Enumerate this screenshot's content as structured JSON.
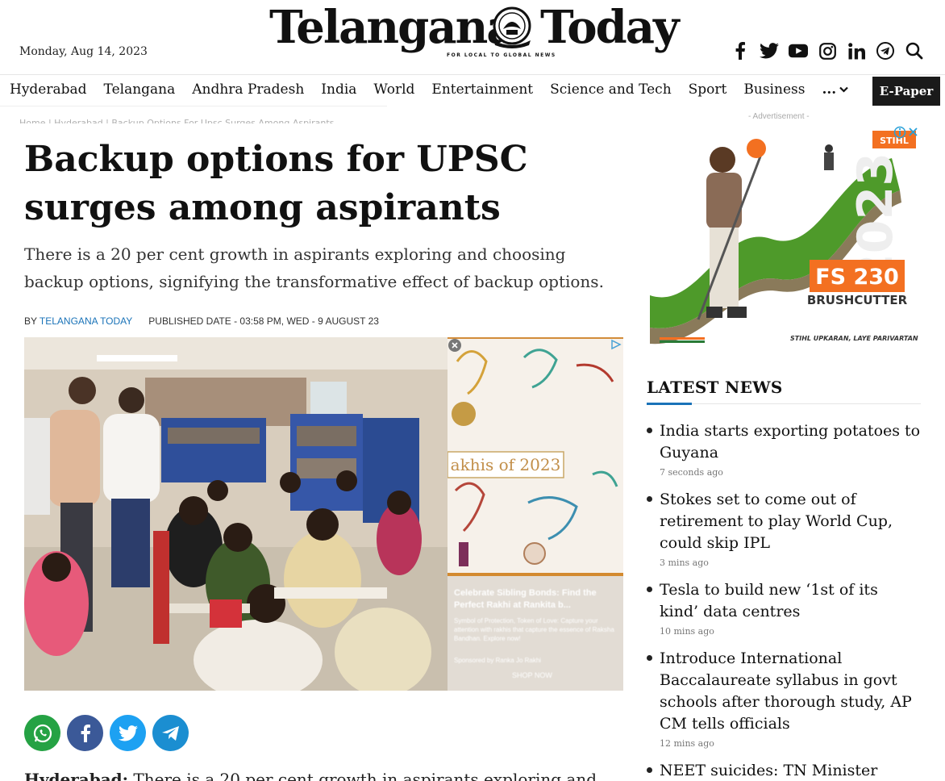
{
  "header": {
    "date": "Monday, Aug 14, 2023",
    "logo_left": "Telangana",
    "logo_right": "Today",
    "logo_tagline": "FOR LOCAL TO GLOBAL NEWS",
    "social_icons": [
      "facebook-icon",
      "twitter-icon",
      "youtube-icon",
      "instagram-icon",
      "linkedin-icon",
      "telegram-icon",
      "search-icon"
    ]
  },
  "nav": {
    "items": [
      "Hyderabad",
      "Telangana",
      "Andhra Pradesh",
      "India",
      "World",
      "Entertainment",
      "Science and Tech",
      "Sport",
      "Business"
    ],
    "more_label": "...",
    "epaper_label": "E-Paper"
  },
  "breadcrumb": "Home | Hyderabad | Backup Options For Upsc Surges Among Aspirants",
  "article": {
    "headline": "Backup options for UPSC surges among aspirants",
    "subheadline": "There is a 20 per cent growth in aspirants exploring and choosing backup options, signifying the transformative effect of backup options.",
    "by_prefix": "BY",
    "author": "Telangana Today",
    "published": "PUBLISHED DATE - 03:58 PM, WED - 9 AUGUST 23",
    "lead_dateline": "Hyderabad:",
    "lead_text": "There is a 20 per cent growth in aspirants exploring and"
  },
  "inline_ad": {
    "heading": "akhis of 2023",
    "caption_title": "Celebrate Sibling Bonds: Find the Perfect Rakhi at Rankita b...",
    "caption_body": "Symbol of Protection, Token of Love: Capture your attention with rakhis that capture the essence of Raksha Bandhan. Explore now!",
    "caption_source": "Sponsored by Ranka Jo Rakhi",
    "cta": "SHOP NOW"
  },
  "right_ad": {
    "label": "- Advertisement -",
    "brand": "STIHL",
    "product_code": "FS 230",
    "product_name": "BRUSHCUTTER",
    "slogan": "STIHL UPKARAN, LAYE PARIVARTAN"
  },
  "latest_news": {
    "heading": "LATEST NEWS",
    "items": [
      {
        "title": "India starts exporting potatoes to Guyana",
        "time": "7 seconds ago"
      },
      {
        "title": "Stokes set to come out of retirement to play World Cup, could skip IPL",
        "time": "3 mins ago"
      },
      {
        "title": "Tesla to build new ‘1st of its kind’ data centres",
        "time": "10 mins ago"
      },
      {
        "title": "Introduce International Baccalaureate syllabus in govt schools after thorough study, AP CM tells officials",
        "time": "12 mins ago"
      },
      {
        "title": "NEET suicides: TN Minister",
        "time": ""
      }
    ]
  },
  "colors": {
    "accent_blue": "#1a73b8",
    "epaper_bg": "#1a1a1a",
    "stihl_orange": "#f37021"
  }
}
